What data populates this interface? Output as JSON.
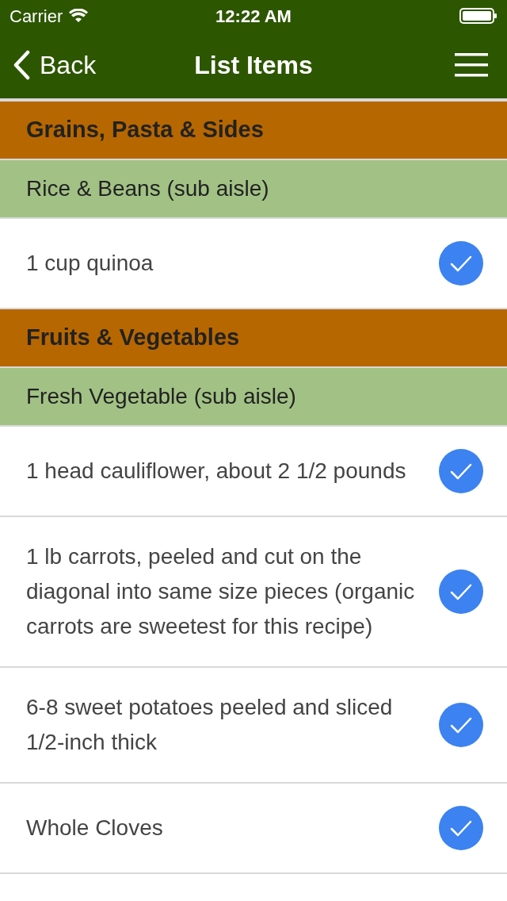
{
  "status_bar": {
    "carrier": "Carrier",
    "time": "12:22 AM"
  },
  "nav": {
    "back": "Back",
    "title": "List Items"
  },
  "rows": [
    {
      "kind": "aisle",
      "text": "Grains, Pasta & Sides"
    },
    {
      "kind": "sub_aisle",
      "text": "Rice & Beans (sub aisle)"
    },
    {
      "kind": "item",
      "text": "1 cup quinoa",
      "checked": true
    },
    {
      "kind": "aisle",
      "text": "Fruits & Vegetables"
    },
    {
      "kind": "sub_aisle",
      "text": "Fresh Vegetable (sub aisle)"
    },
    {
      "kind": "item",
      "text": "1 head cauliflower, about 2 1/2 pounds",
      "checked": true
    },
    {
      "kind": "item",
      "text": "1 lb carrots, peeled and cut on the diagonal into same size pieces (organic carrots are sweetest for this recipe)",
      "checked": true
    },
    {
      "kind": "item",
      "text": "6-8 sweet potatoes peeled and sliced 1/2-inch thick",
      "checked": true
    },
    {
      "kind": "item",
      "text": "Whole Cloves",
      "checked": true
    }
  ]
}
